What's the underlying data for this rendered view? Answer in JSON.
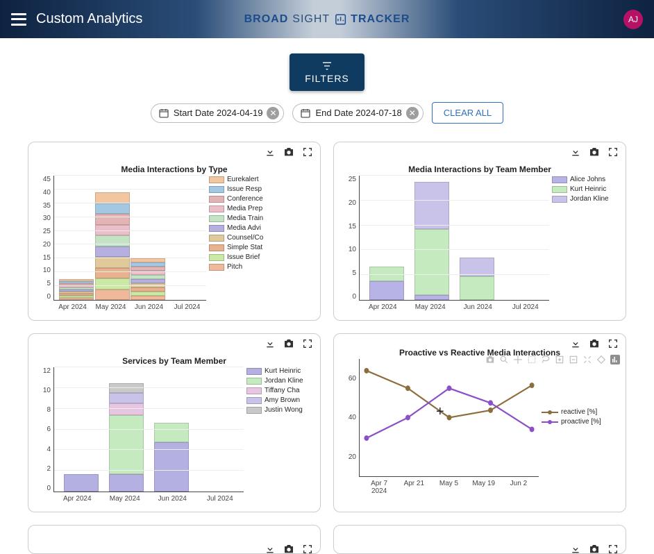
{
  "header": {
    "page_title": "Custom Analytics",
    "brand_left": "BROAD",
    "brand_mid": "SIGHT",
    "brand_right": "TRACKER",
    "avatar": "AJ"
  },
  "filters": {
    "button_label": "FILTERS",
    "chips": [
      {
        "label": "Start Date 2024-04-19"
      },
      {
        "label": "End Date 2024-07-18"
      }
    ],
    "clear_all": "CLEAR ALL"
  },
  "chart_data": [
    {
      "id": "media_by_type",
      "type": "bar",
      "stacked": true,
      "title": "Media Interactions by Type",
      "categories": [
        "Apr 2024",
        "May 2024",
        "Jun 2024",
        "Jul 2024"
      ],
      "ylim": [
        0,
        45
      ],
      "yticks": [
        0,
        5,
        10,
        15,
        20,
        25,
        30,
        35,
        40,
        45
      ],
      "totals": [
        8,
        41,
        16,
        0
      ],
      "legend": [
        "Eurekalert",
        "Issue Resp",
        "Conference",
        "Media Prep",
        "Media Train",
        "Media Advi",
        "Counsel/Co",
        "Simple Stat",
        "Issue Brief",
        "Pitch"
      ],
      "colors": [
        "#f2c6a0",
        "#a5c8e2",
        "#e3b4b4",
        "#ebbec9",
        "#c4e2c4",
        "#b6b0e0",
        "#e0c99b",
        "#e8b28f",
        "#cbe9a3",
        "#f0b99c"
      ]
    },
    {
      "id": "media_by_member",
      "type": "bar",
      "stacked": true,
      "title": "Media Interactions by Team Member",
      "categories": [
        "Apr 2024",
        "May 2024",
        "Jun 2024",
        "Jul 2024"
      ],
      "ylim": [
        0,
        25
      ],
      "yticks": [
        0,
        5,
        10,
        15,
        20,
        25
      ],
      "series": [
        {
          "name": "Alice Johns",
          "color": "#b8b3e6",
          "values": [
            4,
            1,
            0,
            0
          ]
        },
        {
          "name": "Kurt Heinric",
          "color": "#c6eac0",
          "values": [
            3,
            14,
            5,
            0
          ]
        },
        {
          "name": "Jordan Kline",
          "color": "#c9c3ea",
          "values": [
            0,
            10,
            4,
            0
          ]
        }
      ],
      "totals": [
        7,
        25,
        9,
        0
      ]
    },
    {
      "id": "services_by_member",
      "type": "bar",
      "stacked": true,
      "title": "Services by Team Member",
      "categories": [
        "Apr 2024",
        "May 2024",
        "Jun 2024",
        "Jul 2024"
      ],
      "ylim": [
        0,
        12
      ],
      "yticks": [
        0,
        2,
        4,
        6,
        8,
        10,
        12
      ],
      "series": [
        {
          "name": "Kurt Heinric",
          "color": "#b5b0e2",
          "values": [
            1.8,
            1.8,
            5,
            0
          ]
        },
        {
          "name": "Jordan Kline",
          "color": "#c6eac0",
          "values": [
            0,
            6,
            2,
            0
          ]
        },
        {
          "name": "Tiffany Cha",
          "color": "#e7c6e1",
          "values": [
            0,
            1.2,
            0,
            0
          ]
        },
        {
          "name": "Amy Brown",
          "color": "#c9c3ea",
          "values": [
            0,
            1,
            0,
            0
          ]
        },
        {
          "name": "Justin Wong",
          "color": "#c9c9c9",
          "values": [
            0,
            1,
            0,
            0
          ]
        }
      ],
      "totals": [
        1.8,
        11,
        7,
        0
      ]
    },
    {
      "id": "proactive_vs_reactive",
      "type": "line",
      "title": "Proactive vs Reactive Media Interactions",
      "x_labels": [
        "Apr 7 2024",
        "Apr 21",
        "May 5",
        "May 19",
        "Jun 2"
      ],
      "ylim": [
        0,
        80
      ],
      "yticks": [
        20,
        40,
        60
      ],
      "series": [
        {
          "name": "reactive [%]",
          "color": "#8c6d3e",
          "values": [
            72,
            60,
            40,
            45,
            62
          ]
        },
        {
          "name": "proactive [%]",
          "color": "#8a4fc9",
          "values": [
            26,
            40,
            60,
            50,
            32
          ]
        }
      ]
    }
  ]
}
